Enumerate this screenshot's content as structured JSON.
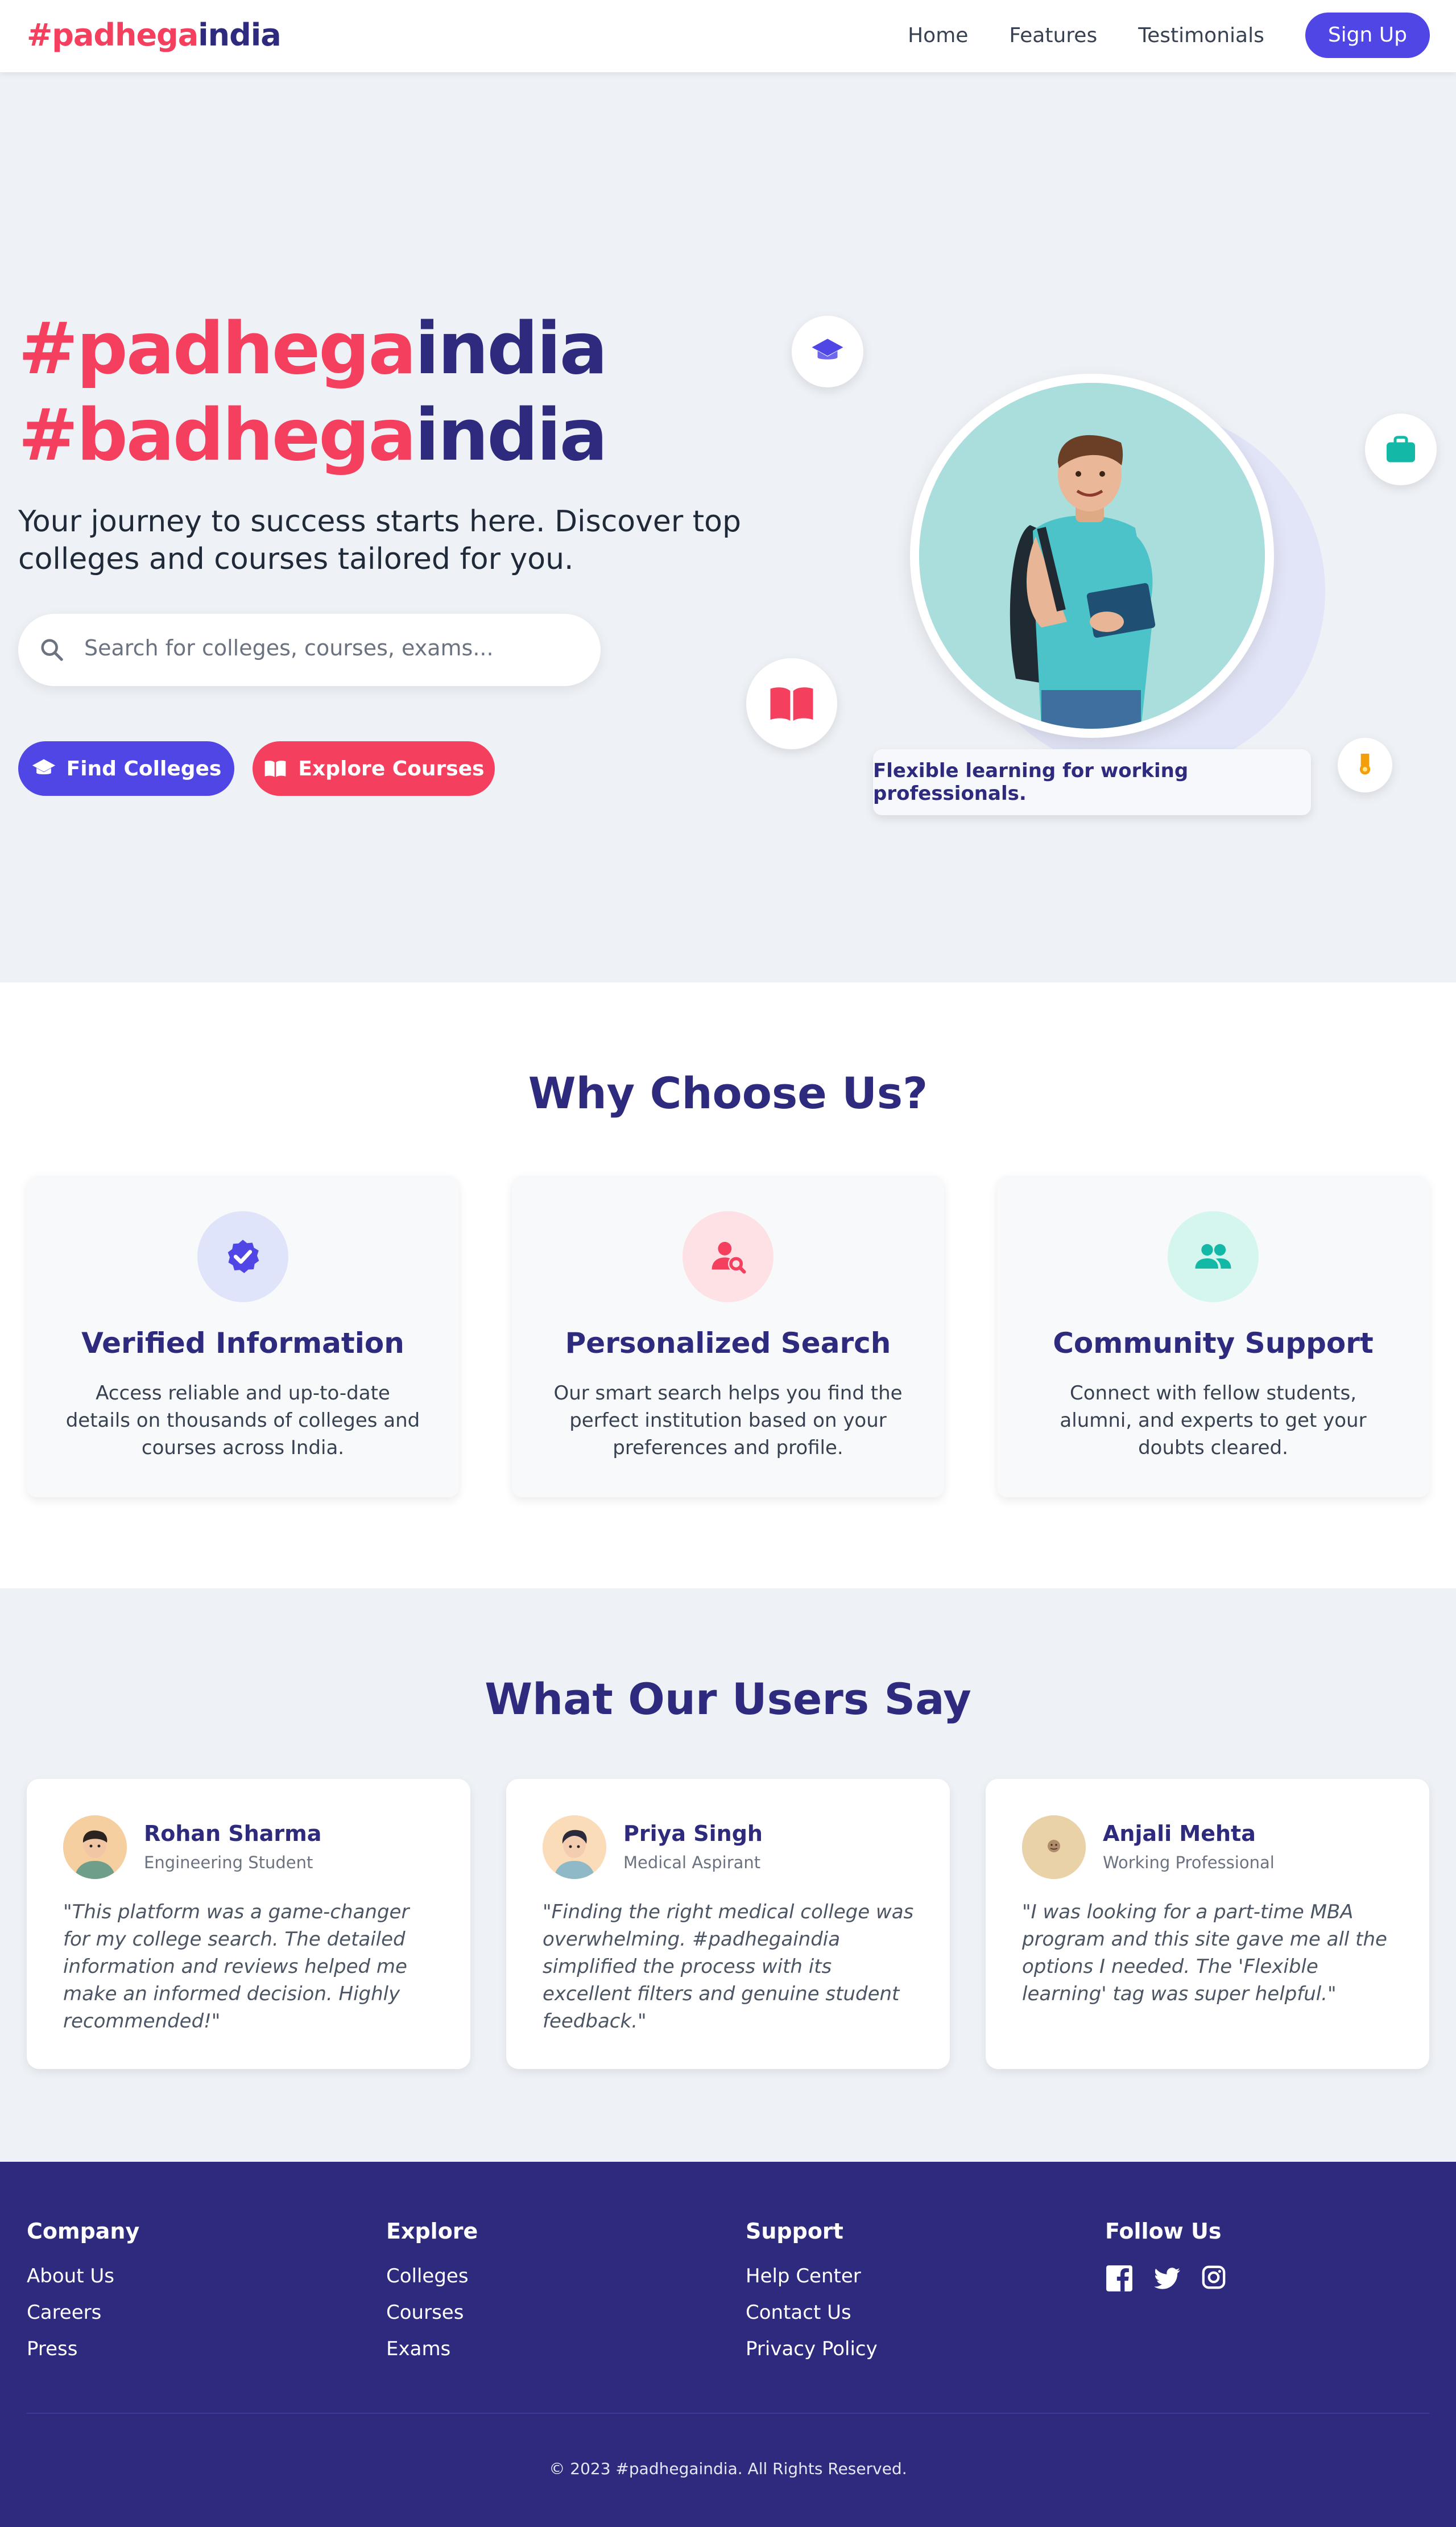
{
  "nav": {
    "logo_part1": "#padhega",
    "logo_part2": "india",
    "links": [
      "Home",
      "Features",
      "Testimonials"
    ],
    "signup_label": "Sign Up"
  },
  "hero": {
    "title_line1_a": "#padhega",
    "title_line1_b": "india",
    "title_line2_a": "#badhega",
    "title_line2_b": "india",
    "subtitle": "Your journey to success starts here. Discover top colleges and courses tailored for you.",
    "search_placeholder": "Search for colleges, courses, exams...",
    "btn_find": "Find Colleges",
    "btn_explore": "Explore Courses",
    "badge": "Flexible learning for working professionals."
  },
  "why": {
    "title": "Why Choose Us?",
    "features": [
      {
        "title": "Verified Information",
        "text": "Access reliable and up-to-date details on thousands of colleges and courses across India.",
        "icon": "verified-badge-icon"
      },
      {
        "title": "Personalized Search",
        "text": "Our smart search helps you find the perfect institution based on your preferences and profile.",
        "icon": "user-search-icon"
      },
      {
        "title": "Community Support",
        "text": "Connect with fellow students, alumni, and experts to get your doubts cleared.",
        "icon": "people-icon"
      }
    ]
  },
  "testimonials": {
    "title": "What Our Users Say",
    "items": [
      {
        "name": "Rohan Sharma",
        "role": "Engineering Student",
        "quote": "\"This platform was a game-changer for my college search. The detailed information and reviews helped me make an informed decision. Highly recommended!\""
      },
      {
        "name": "Priya Singh",
        "role": "Medical Aspirant",
        "quote": "\"Finding the right medical college was overwhelming. #padhegaindia simplified the process with its excellent filters and genuine student feedback.\""
      },
      {
        "name": "Anjali Mehta",
        "role": "Working Professional",
        "quote": "\"I was looking for a part-time MBA program and this site gave me all the options I needed. The 'Flexible learning' tag was super helpful.\""
      }
    ]
  },
  "footer": {
    "columns": [
      {
        "heading": "Company",
        "links": [
          "About Us",
          "Careers",
          "Press"
        ]
      },
      {
        "heading": "Explore",
        "links": [
          "Colleges",
          "Courses",
          "Exams"
        ]
      },
      {
        "heading": "Support",
        "links": [
          "Help Center",
          "Contact Us",
          "Privacy Policy"
        ]
      }
    ],
    "follow_heading": "Follow Us",
    "social_icons": [
      "facebook-icon",
      "twitter-icon",
      "instagram-icon"
    ],
    "copyright": "© 2023 #padhegaindia. All Rights Reserved."
  },
  "colors": {
    "brand_pink": "#f43f5e",
    "brand_navy": "#2e2a7d",
    "accent_blue": "#4f46e5",
    "teal": "#14b8a6",
    "gold": "#f59e0b"
  }
}
